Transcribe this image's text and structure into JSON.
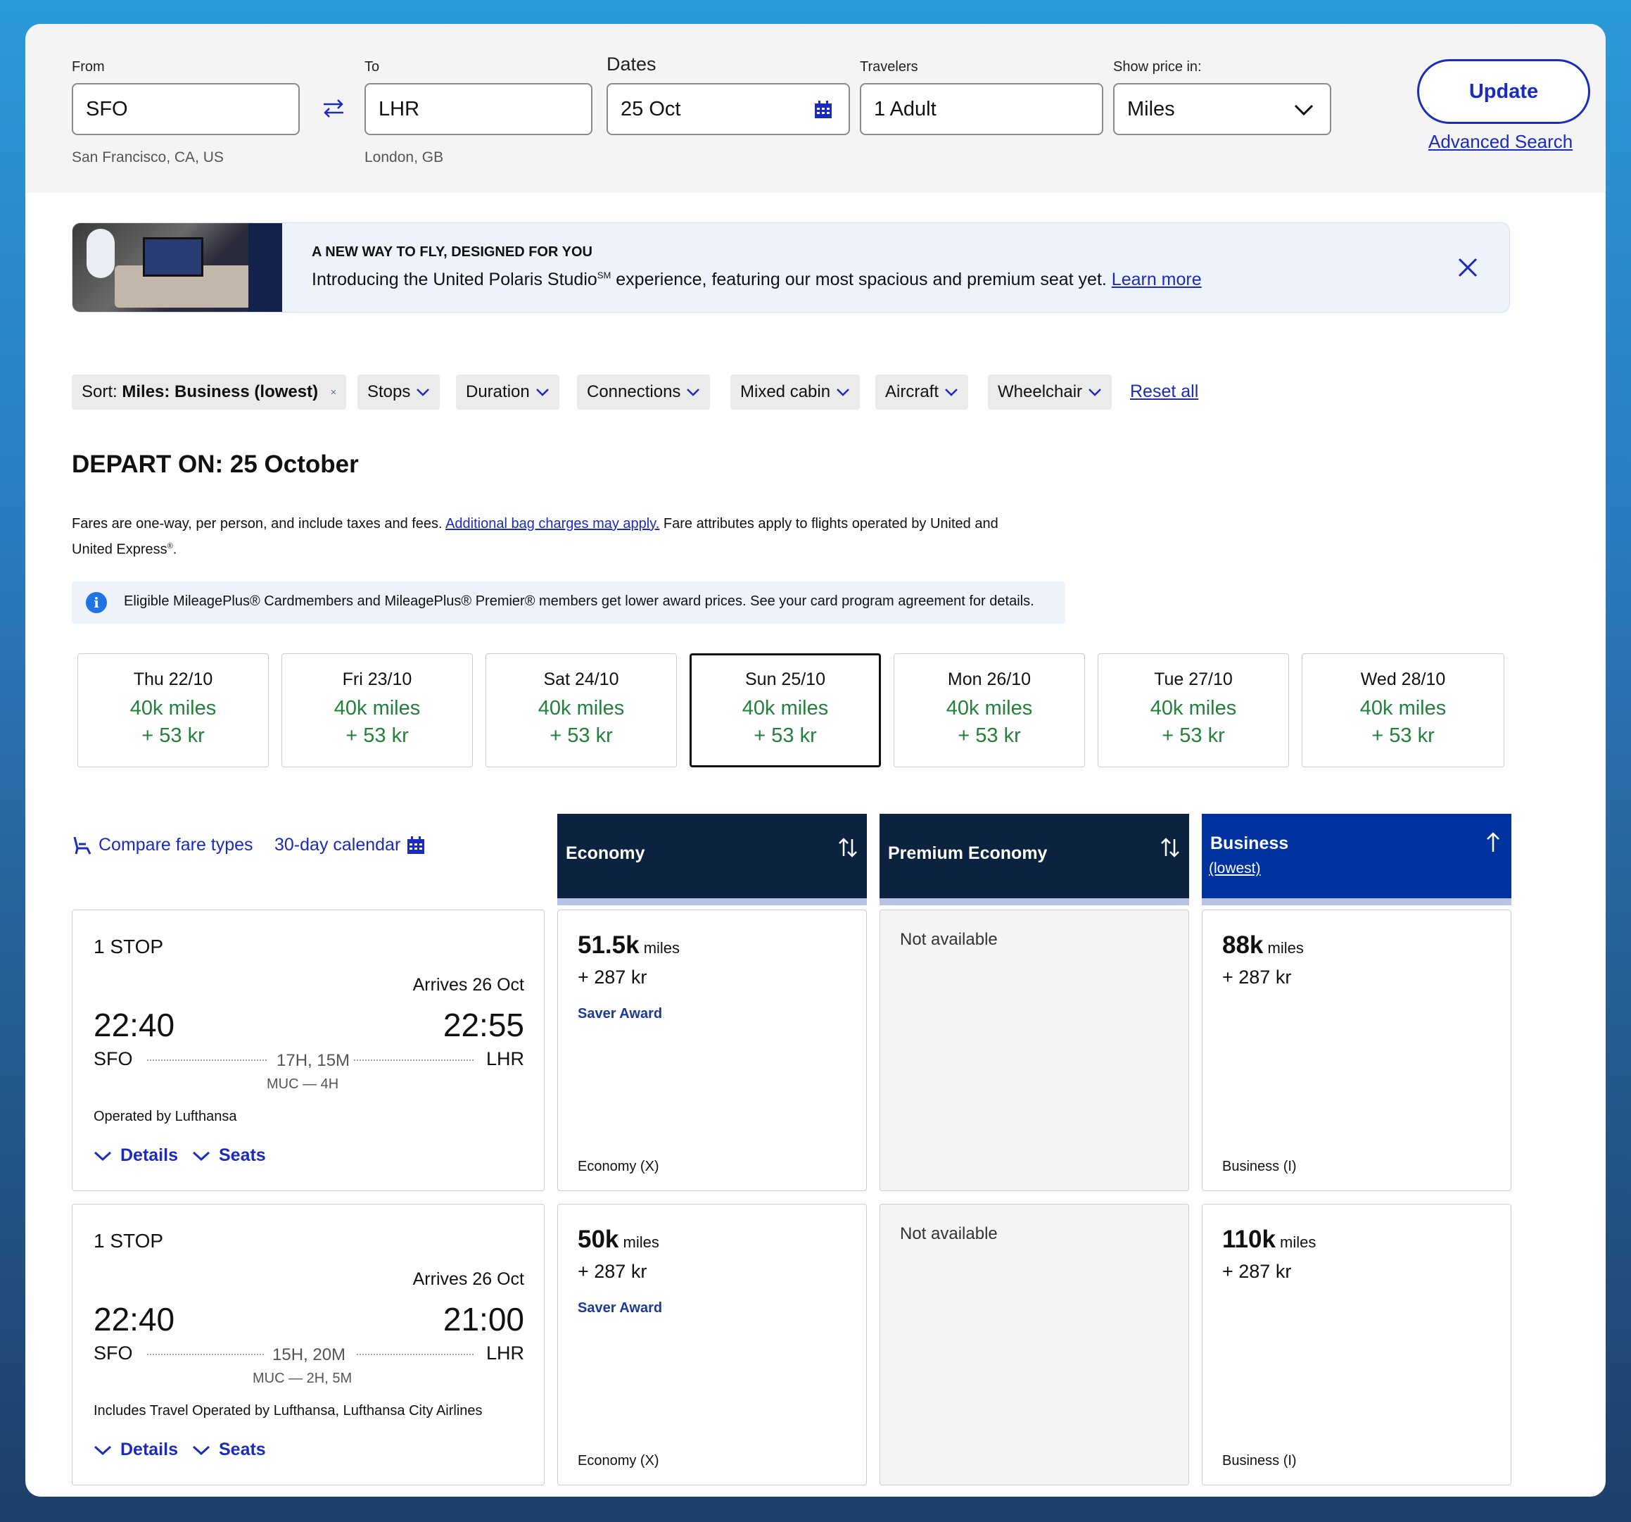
{
  "search": {
    "from_label": "From",
    "from_value": "SFO",
    "from_city": "San Francisco, CA, US",
    "to_label": "To",
    "to_value": "LHR",
    "to_city": "London, GB",
    "dates_label": "Dates",
    "dates_value": "25 Oct",
    "travelers_label": "Travelers",
    "travelers_value": "1 Adult",
    "price_label": "Show price in:",
    "price_value": "Miles",
    "update_label": "Update",
    "advanced_label": "Advanced Search"
  },
  "banner": {
    "title": "A NEW WAY TO FLY, DESIGNED FOR YOU",
    "text": "Introducing the United Polaris Studio",
    "sup": "SM",
    "text_rest": " experience, featuring our most spacious and premium seat yet. ",
    "link": "Learn more"
  },
  "filters": {
    "sort_prefix": "Sort: ",
    "sort_value": "Miles: Business (lowest)",
    "stops": "Stops",
    "duration": "Duration",
    "connections": "Connections",
    "mixed_cabin": "Mixed cabin",
    "aircraft": "Aircraft",
    "wheelchair": "Wheelchair",
    "reset": "Reset all"
  },
  "depart": {
    "title": "DEPART ON: 25 October",
    "note_a": "Fares are one-way, per person, and include taxes and fees. ",
    "note_link": "Additional bag charges may apply.",
    "note_b": " Fare attributes apply to flights operated by United and United Express",
    "note_reg": "®",
    "note_end": ".",
    "info": "Eligible MileagePlus® Cardmembers and MileagePlus® Premier® members get lower award prices. See your card program agreement for details."
  },
  "dates": [
    {
      "day": "Thu 22/10",
      "miles": "40k miles",
      "price": "+ 53 kr"
    },
    {
      "day": "Fri 23/10",
      "miles": "40k miles",
      "price": "+ 53 kr"
    },
    {
      "day": "Sat 24/10",
      "miles": "40k miles",
      "price": "+ 53 kr"
    },
    {
      "day": "Sun 25/10",
      "miles": "40k miles",
      "price": "+ 53 kr"
    },
    {
      "day": "Mon 26/10",
      "miles": "40k miles",
      "price": "+ 53 kr"
    },
    {
      "day": "Tue 27/10",
      "miles": "40k miles",
      "price": "+ 53 kr"
    },
    {
      "day": "Wed 28/10",
      "miles": "40k miles",
      "price": "+ 53 kr"
    }
  ],
  "tools": {
    "compare": "Compare fare types",
    "calendar": "30-day calendar"
  },
  "columns": {
    "economy": "Economy",
    "premium": "Premium Economy",
    "business": "Business",
    "business_sub": "(lowest)"
  },
  "flights": [
    {
      "stops": "1 STOP",
      "arrives": "Arrives 26 Oct",
      "dep_time": "22:40",
      "arr_time": "22:55",
      "origin": "SFO",
      "dest": "LHR",
      "duration": "17H, 15M",
      "via": "MUC — 4H",
      "operated": "Operated by Lufthansa",
      "details": "Details",
      "seats": "Seats",
      "economy": {
        "miles": "51.5k",
        "unit": " miles",
        "tax": "+ 287 kr",
        "award": "Saver Award",
        "cls": "Economy (X)"
      },
      "premium": {
        "na": "Not available"
      },
      "business": {
        "miles": "88k",
        "unit": " miles",
        "tax": "+ 287 kr",
        "cls": "Business (I)"
      }
    },
    {
      "stops": "1 STOP",
      "arrives": "Arrives 26 Oct",
      "dep_time": "22:40",
      "arr_time": "21:00",
      "origin": "SFO",
      "dest": "LHR",
      "duration": "15H, 20M",
      "via": "MUC — 2H, 5M",
      "operated": "Includes Travel Operated by Lufthansa, Lufthansa City Airlines",
      "details": "Details",
      "seats": "Seats",
      "economy": {
        "miles": "50k",
        "unit": " miles",
        "tax": "+ 287 kr",
        "award": "Saver Award",
        "cls": "Economy (X)"
      },
      "premium": {
        "na": "Not available"
      },
      "business": {
        "miles": "110k",
        "unit": " miles",
        "tax": "+ 287 kr",
        "cls": "Business (I)"
      }
    }
  ],
  "colors": {
    "brand_blue": "#1a2bbd",
    "navy": "#0c2340",
    "business_blue": "#0033a0",
    "green": "#23803a"
  },
  "icons": [
    "swap-icon",
    "calendar-icon",
    "chevron-down-icon",
    "close-icon",
    "info-icon",
    "seat-icon",
    "sort-icon",
    "sort-up-icon"
  ]
}
